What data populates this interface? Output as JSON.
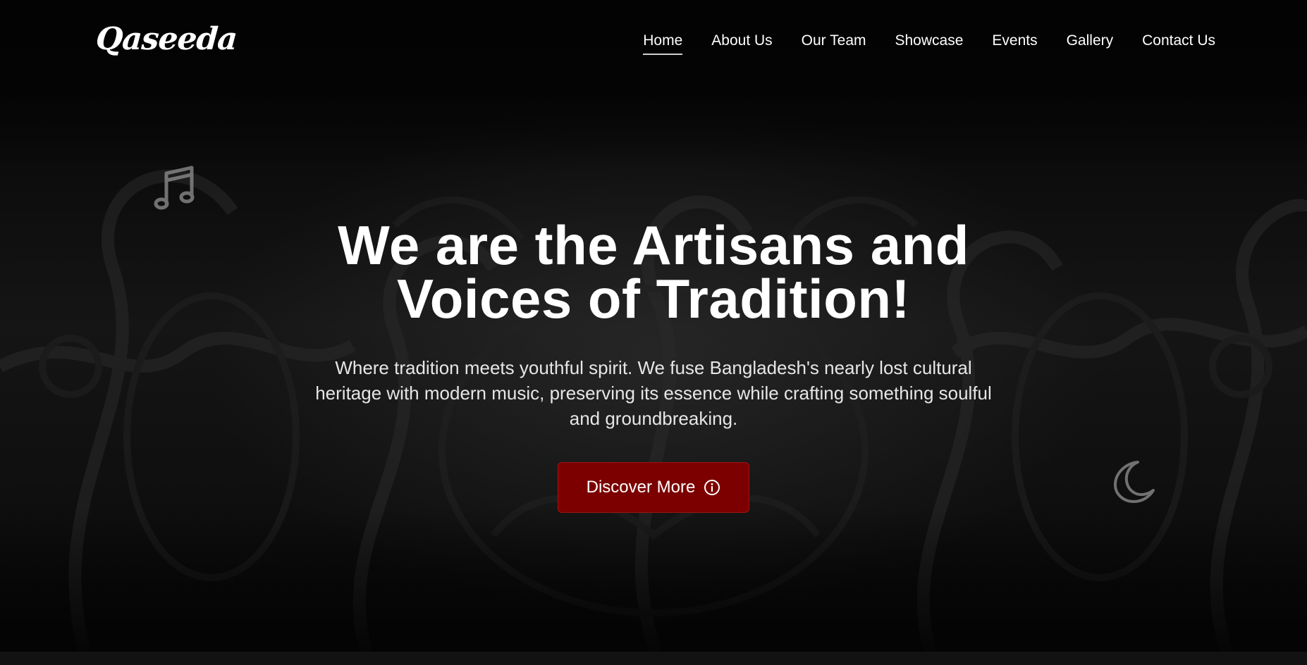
{
  "header": {
    "logo_text": "Qaseeda",
    "nav": [
      {
        "label": "Home",
        "active": true
      },
      {
        "label": "About Us",
        "active": false
      },
      {
        "label": "Our Team",
        "active": false
      },
      {
        "label": "Showcase",
        "active": false
      },
      {
        "label": "Events",
        "active": false
      },
      {
        "label": "Gallery",
        "active": false
      },
      {
        "label": "Contact Us",
        "active": false
      }
    ]
  },
  "hero": {
    "title_line1": "We are the Artisans and",
    "title_line2": "Voices of Tradition!",
    "subtitle": "Where tradition meets youthful spirit. We fuse Bangladesh's nearly lost cultural heritage with modern music, preserving its essence while crafting something soulful and groundbreaking.",
    "cta_label": "Discover More",
    "cta_icon": "info-circle-icon"
  },
  "decor": {
    "left_icon": "music-note-icon",
    "right_icon": "crescent-moon-icon"
  },
  "colors": {
    "background": "#050505",
    "cta": "#7d0000",
    "text": "#ffffff"
  }
}
